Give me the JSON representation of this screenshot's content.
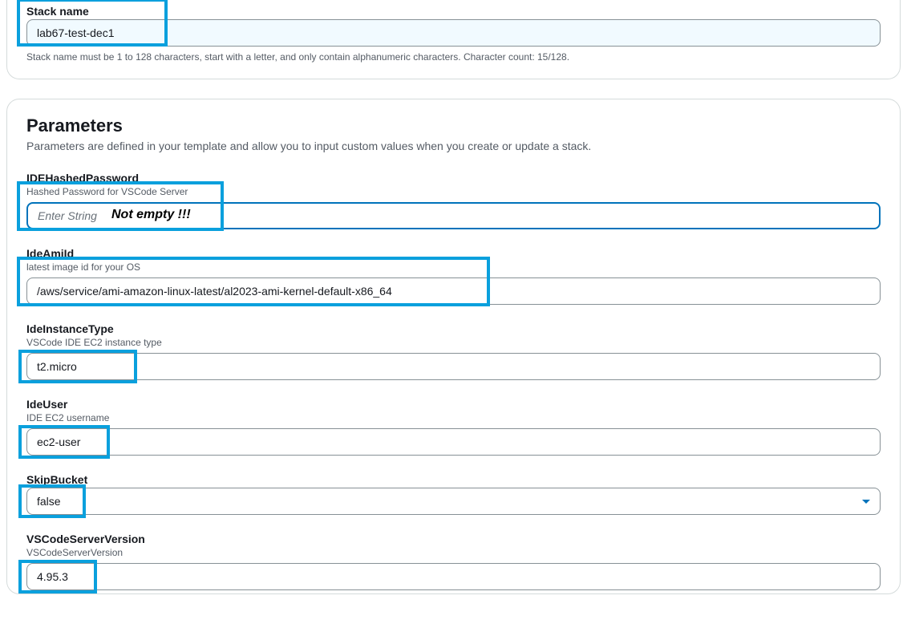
{
  "stack_name": {
    "label": "Stack name",
    "value": "lab67-test-dec1",
    "constraint": "Stack name must be 1 to 128 characters, start with a letter, and only contain alphanumeric characters. Character count: 15/128."
  },
  "parameters_section": {
    "title": "Parameters",
    "description": "Parameters are defined in your template and allow you to input custom values when you create or update a stack."
  },
  "parameters": {
    "ide_hashed_password": {
      "label": "IDEHashedPassword",
      "description": "Hashed Password for VSCode Server",
      "placeholder": "Enter String",
      "value": "",
      "annotation": "Not empty !!!"
    },
    "ide_ami_id": {
      "label": "IdeAmiId",
      "description": "latest image id for your OS",
      "value": "/aws/service/ami-amazon-linux-latest/al2023-ami-kernel-default-x86_64"
    },
    "ide_instance_type": {
      "label": "IdeInstanceType",
      "description": "VSCode IDE EC2 instance type",
      "value": "t2.micro"
    },
    "ide_user": {
      "label": "IdeUser",
      "description": "IDE EC2 username",
      "value": "ec2-user"
    },
    "skip_bucket": {
      "label": "SkipBucket",
      "value": "false"
    },
    "vscode_server_version": {
      "label": "VSCodeServerVersion",
      "description": "VSCodeServerVersion",
      "value": "4.95.3"
    }
  }
}
